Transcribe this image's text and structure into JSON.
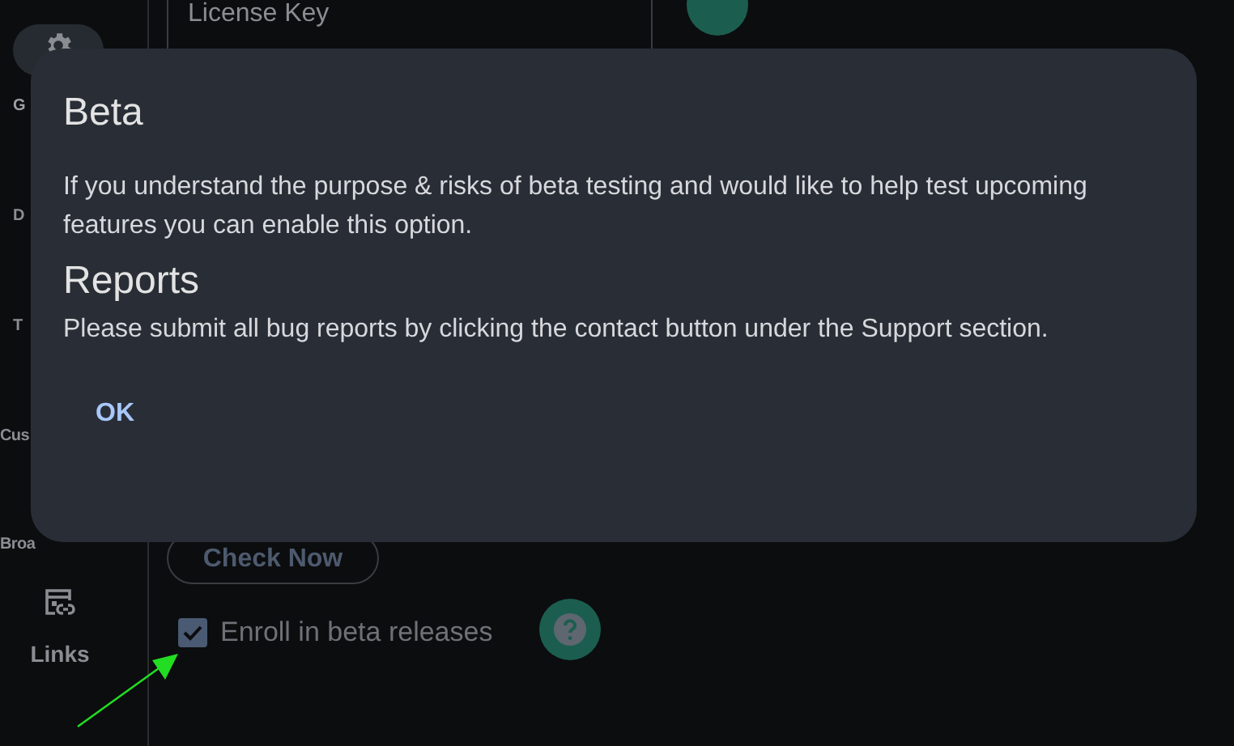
{
  "sidebar": {
    "items": [
      {
        "label": "G",
        "kind": "gear",
        "selected": true
      },
      {
        "label": "D",
        "selected": false
      },
      {
        "label": "T",
        "selected": false
      },
      {
        "label": "Cus",
        "selected": false
      },
      {
        "label": "Broa",
        "selected": false
      },
      {
        "label": "Links",
        "kind": "links",
        "selected": false
      }
    ]
  },
  "license_field": {
    "placeholder": "License Key"
  },
  "check_button": "Check Now",
  "beta_checkbox": {
    "label": "Enroll in beta releases",
    "checked": true
  },
  "dialog": {
    "sections": [
      {
        "heading": "Beta",
        "text": "If you understand the purpose & risks of beta testing and would like to help test upcoming features you can enable this option."
      },
      {
        "heading": "Reports",
        "text": "Please submit all bug reports by clicking the contact button under the Support section."
      }
    ],
    "button": "OK"
  }
}
